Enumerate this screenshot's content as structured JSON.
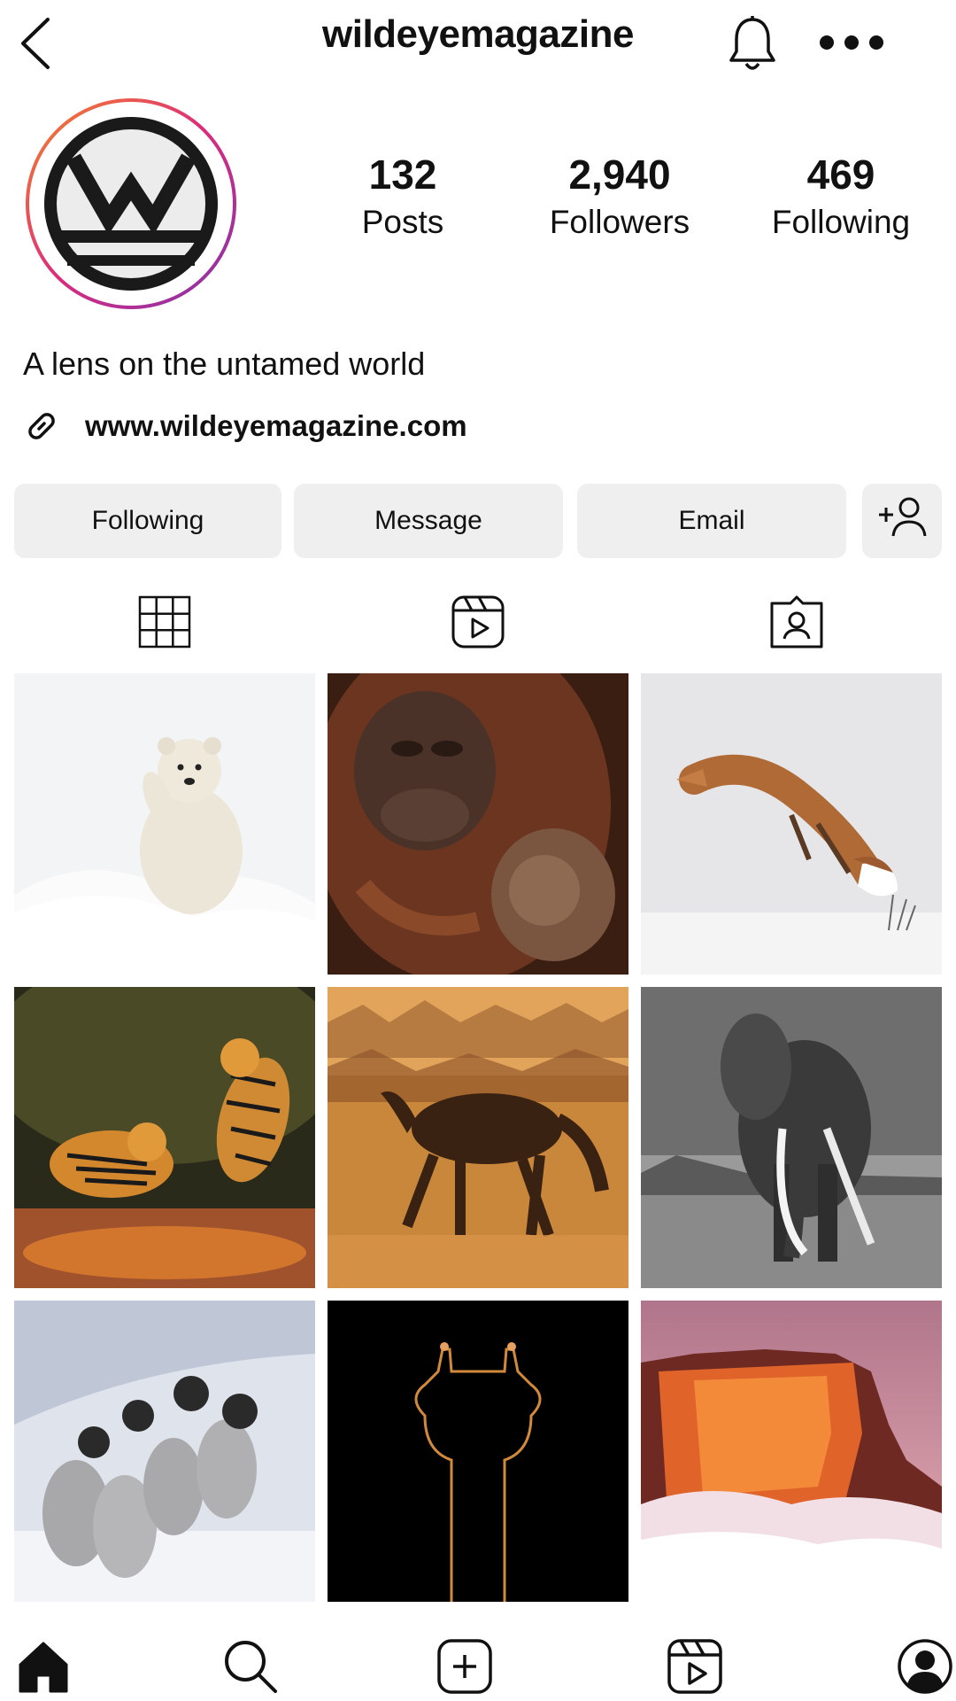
{
  "header": {
    "username": "wildeyemagazine",
    "icons": [
      "back-icon",
      "bell-icon",
      "more-icon"
    ]
  },
  "profile": {
    "stats": [
      {
        "value": "132",
        "label": "Posts"
      },
      {
        "value": "2,940",
        "label": "Followers"
      },
      {
        "value": "469",
        "label": "Following"
      }
    ],
    "bio": "A lens on the untamed world",
    "website": "www.wildeyemagazine.com"
  },
  "actions": {
    "following_label": "Following",
    "message_label": "Message",
    "email_label": "Email"
  },
  "tabs": [
    "grid-icon",
    "reels-icon",
    "tagged-icon"
  ],
  "grid": {
    "posts": [
      "polar bear cub waving in snow",
      "orangutan mother with baby",
      "red fox leaping over snow",
      "two tigers fighting",
      "horses running in dust",
      "elephant with long tusks (black and white)",
      "emperor penguin chicks in snow",
      "giraffe silhouette rim-lit on black",
      "glowing cliff above clouds at sunset"
    ]
  },
  "bottom_nav": [
    "home-icon",
    "search-icon",
    "create-icon",
    "reels-icon",
    "profile-icon"
  ],
  "colors": {
    "avatar_ring_start": "#f58529",
    "avatar_ring_end": "#8134af",
    "button_bg": "#efefef",
    "text": "#111111"
  }
}
